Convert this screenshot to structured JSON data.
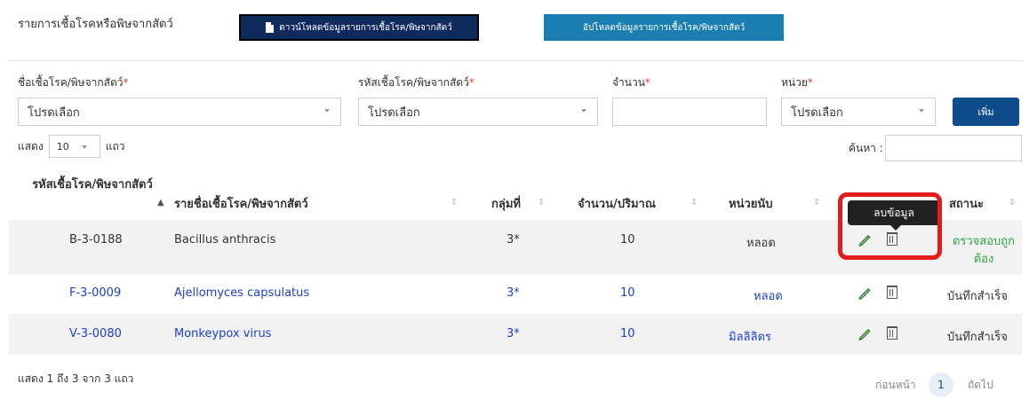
{
  "header": {
    "title": "รายการเชื้อโรคหรือพิษจากสัตว์",
    "download_label": "ดาวน์โหลดข้อมูลรายการเชื้อโรค/พิษจากสัตว์",
    "upload_label": "อัปโหลดข้อมูลรายการเชื้อโรค/พิษจากสัตว์"
  },
  "form": {
    "pathogen_name_label": "ชื่อเชื้อโรค/พิษจากสัตว์",
    "pathogen_code_label": "รหัสเชื้อโรค/พิษจากสัตว์",
    "amount_label": "จำนวน",
    "unit_label": "หน่วย",
    "required_mark": "*",
    "pathogen_name_value": "โปรดเลือก",
    "pathogen_code_value": "โปรดเลือก",
    "amount_value": "",
    "unit_value": "โปรดเลือก",
    "add_label": "เพิ่ม"
  },
  "table_controls": {
    "show_label": "แสดง",
    "page_length": "10",
    "rows_label": "แถว",
    "search_label": "ค้นหา :",
    "search_value": ""
  },
  "table": {
    "columns": [
      "รหัสเชื้อโรค/พิษจากสัตว์",
      "รายชื่อเชื้อโรค/พิษจากสัตว์",
      "กลุ่มที่",
      "จำนวน/ปริมาณ",
      "หน่วยนับ",
      "",
      "สถานะ"
    ],
    "rows": [
      {
        "code": "B-3-0188",
        "name": "Bacillus anthracis",
        "group": "3*",
        "amount": "10",
        "unit": "หลอด",
        "status": "ตรวจสอบถูกต้อง",
        "status_color": "#28a745"
      },
      {
        "code": "F-3-0009",
        "name": "Ajellomyces capsulatus",
        "group": "3*",
        "amount": "10",
        "unit": "หลอด",
        "status": "บันทึกสำเร็จ",
        "status_color": "#333333"
      },
      {
        "code": "V-3-0080",
        "name": "Monkeypox virus",
        "group": "3*",
        "amount": "10",
        "unit": "มิลลิลิตร",
        "status": "บันทึกสำเร็จ",
        "status_color": "#333333"
      }
    ],
    "tooltip": "ลบข้อมูล"
  },
  "footer": {
    "info": "แสดง 1 ถึง 3 จาก 3 แถว",
    "prev_label": "ก่อนหน้า",
    "current_page": "1",
    "next_label": "ถัดไป"
  },
  "colors": {
    "primary_dark": "#0f2b5e",
    "primary": "#1a7fb0",
    "link_blue": "#1a3fcf",
    "success": "#28a745",
    "highlight": "#e41c1c"
  }
}
